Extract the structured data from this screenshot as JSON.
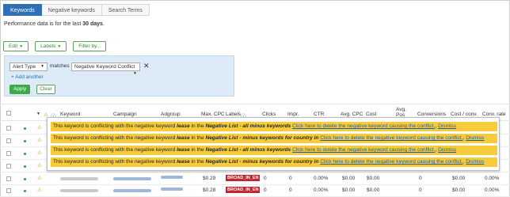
{
  "tabs": [
    {
      "label": "Keywords",
      "active": true
    },
    {
      "label": "Negative keywords",
      "active": false
    },
    {
      "label": "Search Terms",
      "active": false
    }
  ],
  "performance": {
    "prefix": "Performance data is for the last",
    "period": "30 days",
    "suffix": "."
  },
  "toolbar": {
    "edit": "Edit",
    "labels": "Labels",
    "filter": "Filter by..."
  },
  "filter": {
    "field": "Alert Type",
    "operator": "matches",
    "value": "Negative Keyword Conflict",
    "add_another": "+ Add another",
    "apply": "Apply",
    "clear": "Clear"
  },
  "table": {
    "headers": [
      "Keyword",
      "Campaign",
      "Adgroup",
      "Max. CPC",
      "Labels",
      "Clicks",
      "Impr.",
      "CTR",
      "Avg. CPC",
      "Cost",
      "Avg. Pos",
      "Conversions",
      "Cost / conv.",
      "Conv. rate"
    ],
    "rows": [
      {
        "max_cpc": "",
        "label": "",
        "clicks": "",
        "impr": "",
        "ctr": "",
        "avg_cpc": "",
        "cost": "",
        "conv": "",
        "cost_conv": "",
        "conv_rate": ""
      },
      {
        "max_cpc": "",
        "label": "",
        "clicks": "",
        "impr": "",
        "ctr": "",
        "avg_cpc": "",
        "cost": "",
        "conv": "",
        "cost_conv": "",
        "conv_rate": ""
      },
      {
        "max_cpc": "",
        "label": "",
        "clicks": "",
        "impr": "",
        "ctr": "",
        "avg_cpc": "",
        "cost": "",
        "conv": "",
        "cost_conv": "",
        "conv_rate": ""
      },
      {
        "max_cpc": "",
        "label": "",
        "clicks": "",
        "impr": "",
        "ctr": "",
        "avg_cpc": "",
        "cost": "",
        "conv": "",
        "cost_conv": "",
        "conv_rate": ""
      },
      {
        "max_cpc": "$0.29",
        "label": "BROAD_IN_EN",
        "clicks": "0",
        "impr": "0",
        "ctr": "0.00%",
        "avg_cpc": "$0.00",
        "cost": "$0.00",
        "conv": "0",
        "cost_conv": "$0.00",
        "conv_rate": "0.00%"
      },
      {
        "max_cpc": "$0.28",
        "label": "BROAD_IN_EN",
        "clicks": "0",
        "impr": "0",
        "ctr": "0.00%",
        "avg_cpc": "$0.00",
        "cost": "$0.00",
        "conv": "0",
        "cost_conv": "$0.00",
        "conv_rate": "0.00%"
      }
    ]
  },
  "conflicts": [
    {
      "text": "This keyword is conflicting with the negative keyword",
      "keyword": "lease",
      "in": "in the",
      "list": "Negative List - all minus keywords",
      "delete": "Click here to delete the negative keyword causing the conflict.",
      "dismiss": "Dismiss"
    },
    {
      "text": "This keyword is conflicting with the negative keyword",
      "keyword": "lease",
      "in": "in the",
      "list": "Negative List - minus keywords for country in",
      "delete": "Click here to delete the negative keyword causing the conflict.",
      "dismiss": "Dismiss"
    },
    {
      "text": "This keyword is conflicting with the negative keyword",
      "keyword": "lease",
      "in": "in the",
      "list": "Negative List - all minus keywords",
      "delete": "Click here to delete the negative keyword causing the conflict.",
      "dismiss": "Dismiss"
    },
    {
      "text": "This keyword is conflicting with the negative keyword",
      "keyword": "lease",
      "in": "in the",
      "list": "Negative List - minus keywords for country in",
      "delete": "Click here to delete the negative keyword causing the conflict.",
      "dismiss": "Dismiss"
    }
  ],
  "colors": {
    "tab_active": "#2f6fb6",
    "conflict_bg": "#f7cc3a",
    "label_tag": "#c0262d",
    "apply": "#3fa84a"
  }
}
